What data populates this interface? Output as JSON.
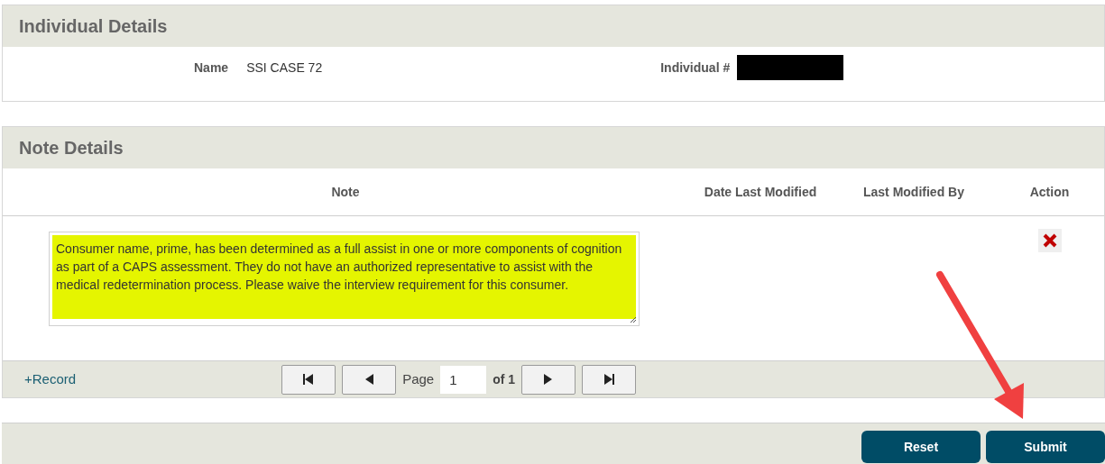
{
  "individual": {
    "title": "Individual Details",
    "name_label": "Name",
    "name_value": "SSI CASE 72",
    "number_label": "Individual #"
  },
  "notes": {
    "title": "Note Details",
    "columns": [
      "Note",
      "Date Last Modified",
      "Last Modified By",
      "Action"
    ],
    "rows": [
      {
        "note": "Consumer name, prime, has been determined as a full assist in one or more components of cognition as part of a CAPS assessment. They do not have an authorized representative to assist with the medical redetermination process. Please waive the interview requirement for this consumer.",
        "highlighted": true
      }
    ],
    "add_link": "+Record",
    "pager": {
      "page_label": "Page",
      "page_value": "1",
      "of_label": "of 1"
    }
  },
  "buttons": [
    "Reset",
    "Submit"
  ]
}
